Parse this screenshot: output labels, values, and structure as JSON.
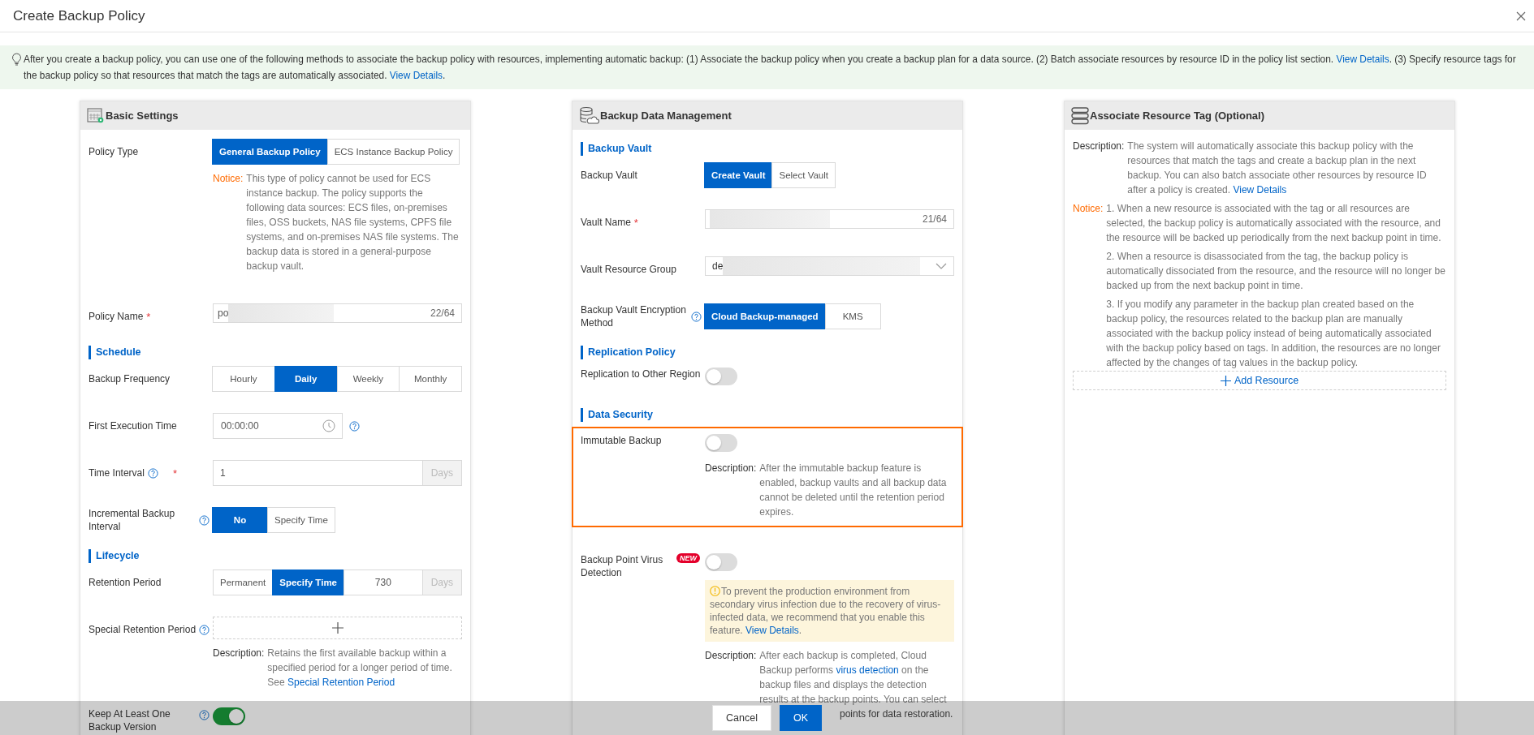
{
  "window": {
    "title": "Create Backup Policy"
  },
  "banner": {
    "segments": [
      {
        "kind": "text",
        "text": "After you create a backup policy, you can use one of the following methods to associate the backup policy with resources, implementing automatic backup: (1) Associate the backup policy when you create a backup plan for a data source. (2) Batch associate resources by resource ID in the policy list section. "
      },
      {
        "kind": "link",
        "text": "View Details"
      },
      {
        "kind": "text",
        "text": ". (3) Specify resource tags for the backup policy so that resources that match the tags are automatically associated. "
      },
      {
        "kind": "link",
        "text": "View Details"
      },
      {
        "kind": "text",
        "text": "."
      }
    ]
  },
  "panels": [
    {
      "title": "Basic Settings",
      "rows": [
        {
          "kind": "segmented",
          "label": "Policy Type",
          "options": [
            {
              "label": "General Backup Policy",
              "selected": true
            },
            {
              "label": "ECS Instance Backup Policy",
              "selected": false
            }
          ]
        },
        {
          "kind": "notice_note",
          "tag": "Notice:",
          "segments": [
            {
              "kind": "text",
              "text": "This type of policy cannot be used for ECS instance backup. The policy supports the following data sources: ECS files, on-premises files, OSS buckets, NAS file systems, CPFS file systems, and on-premises NAS file systems. The backup data is stored in a general-purpose backup vault."
            }
          ]
        },
        {
          "kind": "input",
          "label": "Policy Name",
          "required": "*",
          "value": "po",
          "masked": true,
          "counter": "22/64"
        },
        {
          "kind": "section",
          "title": "Schedule"
        },
        {
          "kind": "segmented",
          "label": "Backup Frequency",
          "options": [
            {
              "label": "Hourly",
              "selected": false
            },
            {
              "label": "Daily",
              "selected": true
            },
            {
              "label": "Weekly",
              "selected": false
            },
            {
              "label": "Monthly",
              "selected": false
            }
          ]
        },
        {
          "kind": "time",
          "label": "First Execution Time",
          "help": true,
          "value": "00:00:00"
        },
        {
          "kind": "number",
          "label": "Time Interval",
          "help": true,
          "required": "*",
          "value": "1",
          "unit": "Days"
        },
        {
          "kind": "segmented",
          "label": "Incremental Backup Interval",
          "help": true,
          "options": [
            {
              "label": "No",
              "selected": true
            },
            {
              "label": "Specify Time",
              "selected": false
            }
          ]
        },
        {
          "kind": "section",
          "title": "Lifecycle"
        },
        {
          "kind": "retention",
          "label": "Retention Period",
          "options": [
            {
              "label": "Permanent",
              "selected": false
            },
            {
              "label": "Specify Time",
              "selected": true
            }
          ],
          "value": "730",
          "unit": "Days"
        },
        {
          "kind": "add",
          "label": "Special Retention Period",
          "help": true,
          "note": {
            "tag": "Description:",
            "segments": [
              {
                "kind": "text",
                "text": "Retains the first available backup within a specified period for a longer period of time. See "
              },
              {
                "kind": "link",
                "text": "Special Retention Period"
              }
            ]
          }
        },
        {
          "kind": "switch",
          "label": "Keep At Least One Backup Version",
          "help": true,
          "on": true
        }
      ]
    },
    {
      "title": "Backup Data Management",
      "rows": [
        {
          "kind": "section",
          "title": "Backup Vault"
        },
        {
          "kind": "segmented",
          "label": "Backup Vault",
          "options": [
            {
              "label": "Create Vault",
              "selected": true
            },
            {
              "label": "Select Vault",
              "selected": false
            }
          ]
        },
        {
          "kind": "input",
          "label": "Vault Name",
          "required": "*",
          "masked": true,
          "counter": "21/64"
        },
        {
          "kind": "select",
          "label": "Vault Resource Group",
          "value": "de",
          "masked": true
        },
        {
          "kind": "segmented",
          "label": "Backup Vault Encryption Method",
          "help": true,
          "options": [
            {
              "label": "Cloud Backup-managed",
              "selected": true
            },
            {
              "label": "KMS",
              "selected": false
            }
          ]
        },
        {
          "kind": "section",
          "title": "Replication Policy"
        },
        {
          "kind": "switch",
          "label": "Replication to Other Region",
          "on": false
        },
        {
          "kind": "section",
          "title": "Data Security"
        },
        {
          "kind": "switch",
          "label": "Immutable Backup",
          "on": false,
          "highlighted": true,
          "note": {
            "tag": "Description:",
            "segments": [
              {
                "kind": "text",
                "text": "After the immutable backup feature is enabled, backup vaults and all backup data cannot be deleted until the retention period expires."
              }
            ]
          }
        },
        {
          "kind": "switch",
          "label": "Backup Point Virus Detection",
          "badge": "NEW",
          "on": false,
          "alert": [
            {
              "kind": "text",
              "text": "To prevent the production environment from secondary virus infection due to the recovery of virus-infected data, we recommend that you enable this feature. "
            },
            {
              "kind": "link",
              "text": "View Details"
            },
            {
              "kind": "text",
              "text": "."
            }
          ],
          "note": {
            "tag": "Description:",
            "segments": [
              {
                "kind": "text",
                "text": "After each backup is completed, Cloud Backup performs "
              },
              {
                "kind": "link",
                "text": "virus detection"
              },
              {
                "kind": "text",
                "text": " on the backup files and displays the detection results at the backup points. You can select"
              }
            ],
            "tail": "points for data restoration."
          }
        }
      ]
    },
    {
      "title": "Associate Resource Tag (Optional)",
      "rows": [
        {
          "kind": "wide_note",
          "tag": "Description:",
          "segments": [
            {
              "kind": "text",
              "text": "The system will automatically associate this backup policy with the resources that match the tags and create a backup plan in the next backup. You can also batch associate other resources by resource ID after a policy is created. "
            },
            {
              "kind": "link",
              "text": "View Details"
            }
          ]
        },
        {
          "kind": "notice_list",
          "tag": "Notice:",
          "items": [
            "1. When a new resource is associated with the tag or all resources are selected, the backup policy is automatically associated with the resource, and the resource will be backed up periodically from the next backup point in time.",
            "2. When a resource is disassociated from the tag, the backup policy is automatically dissociated from the resource, and the resource will no longer be backed up from the next backup point in time.",
            "3. If you modify any parameter in the backup plan created based on the backup policy, the resources related to the backup plan are manually associated with the backup policy instead of being automatically associated with the backup policy based on tags. In addition, the resources are no longer affected by the changes of tag values in the backup policy."
          ]
        },
        {
          "kind": "add_button",
          "label": "Add Resource"
        }
      ]
    }
  ],
  "footer": {
    "buttons": [
      {
        "label": "Cancel",
        "kind": "default"
      },
      {
        "label": "OK",
        "kind": "primary"
      }
    ]
  }
}
